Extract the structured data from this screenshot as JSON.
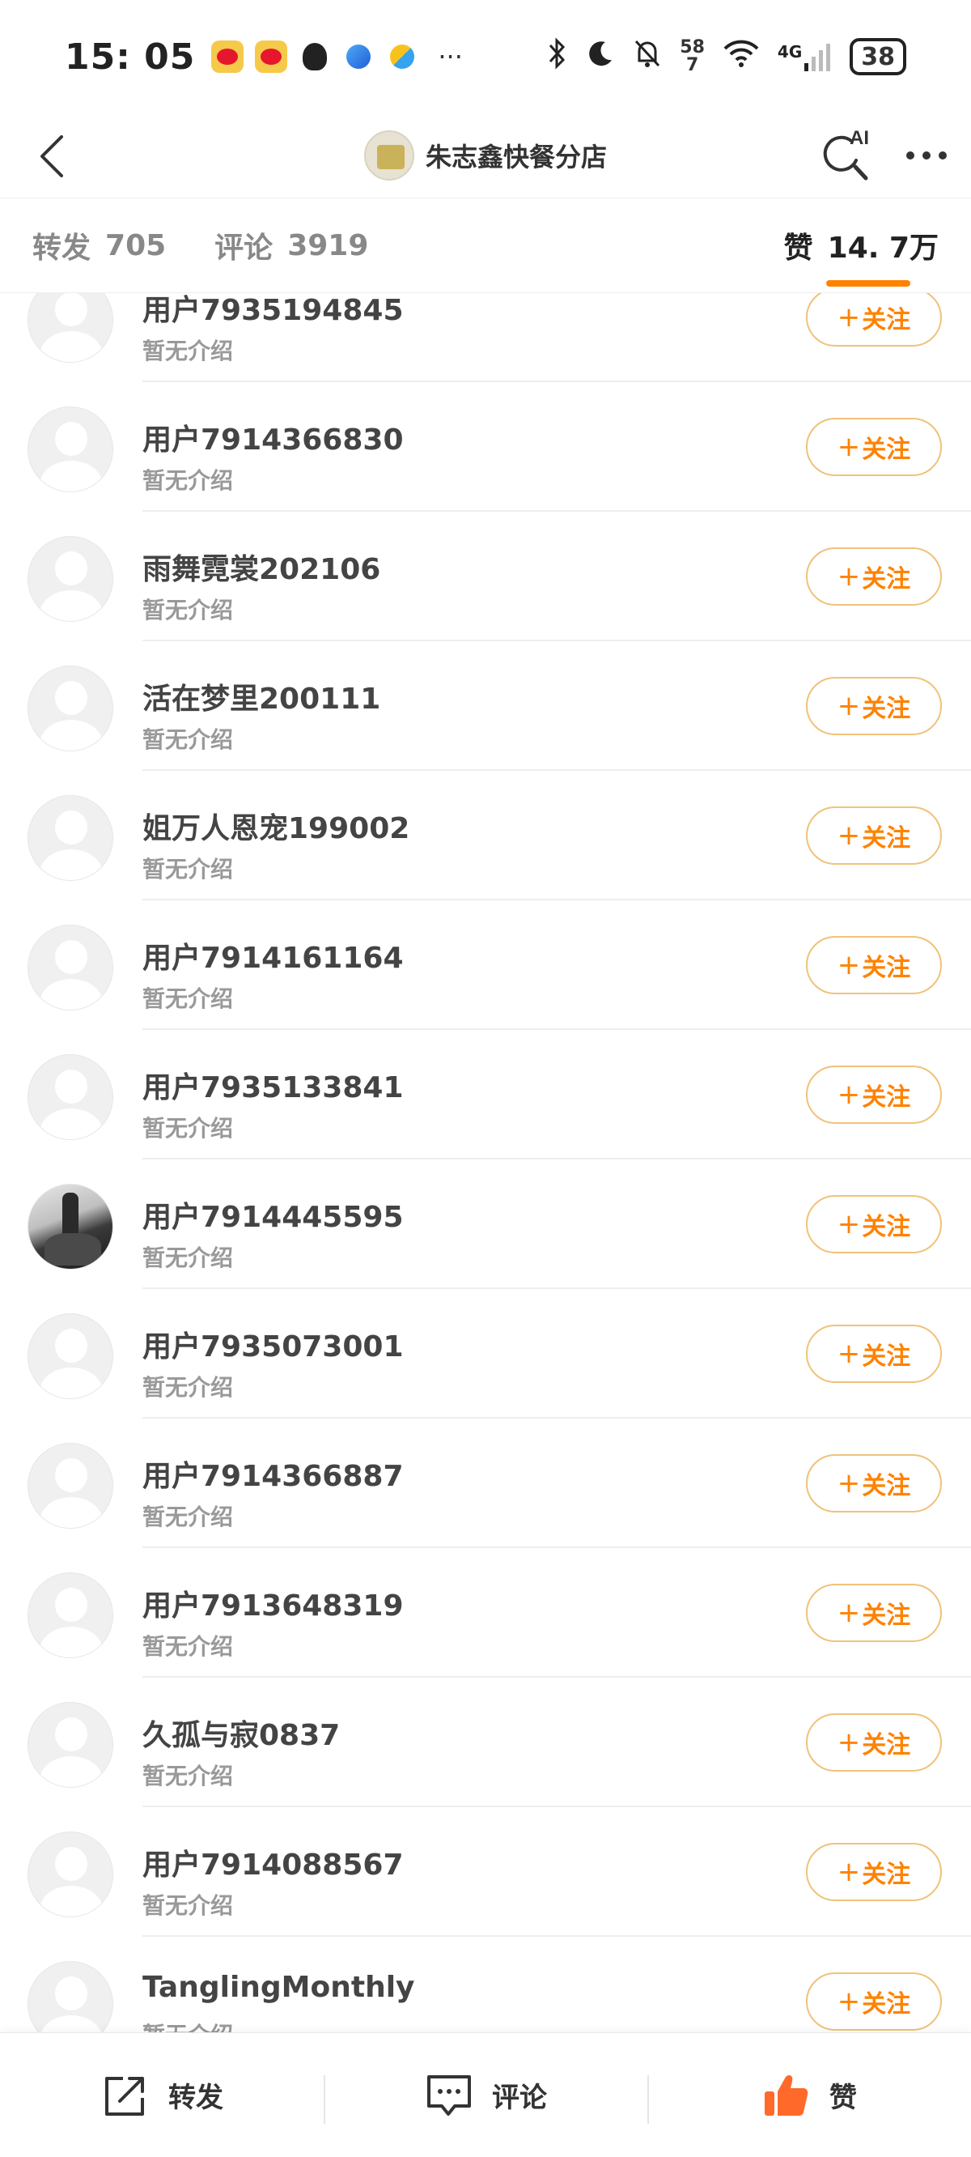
{
  "status_bar": {
    "time": "15: 05",
    "net_speed_top": "58",
    "net_speed_bottom": "7",
    "signal_label": "4G",
    "battery": "38"
  },
  "header": {
    "title": "朱志鑫快餐分店",
    "ai_label": "AI"
  },
  "tabs": [
    {
      "label": "转发",
      "count": "705"
    },
    {
      "label": "评论",
      "count": "3919"
    },
    {
      "label": "赞",
      "count": "14. 7万"
    }
  ],
  "follow_label": "关注",
  "follow_plus": "+",
  "users": [
    {
      "name": "用户7935194845",
      "bio": "暂无介绍"
    },
    {
      "name": "用户7914366830",
      "bio": "暂无介绍"
    },
    {
      "name": "雨舞霓裳202106",
      "bio": "暂无介绍"
    },
    {
      "name": "活在梦里200111",
      "bio": "暂无介绍"
    },
    {
      "name": "姐万人恩宠199002",
      "bio": "暂无介绍"
    },
    {
      "name": "用户7914161164",
      "bio": "暂无介绍"
    },
    {
      "name": "用户7935133841",
      "bio": "暂无介绍"
    },
    {
      "name": "用户7914445595",
      "bio": "暂无介绍"
    },
    {
      "name": "用户7935073001",
      "bio": "暂无介绍"
    },
    {
      "name": "用户7914366887",
      "bio": "暂无介绍"
    },
    {
      "name": "用户7913648319",
      "bio": "暂无介绍"
    },
    {
      "name": "久孤与寂0837",
      "bio": "暂无介绍"
    },
    {
      "name": "用户7914088567",
      "bio": "暂无介绍"
    },
    {
      "name": "TanglingMonthly",
      "bio": "暂无介绍"
    }
  ],
  "bottom_bar": {
    "repost": "转发",
    "comment": "评论",
    "like": "赞"
  },
  "colors": {
    "accent": "#ff8200",
    "like_icon": "#ff6a2b"
  }
}
